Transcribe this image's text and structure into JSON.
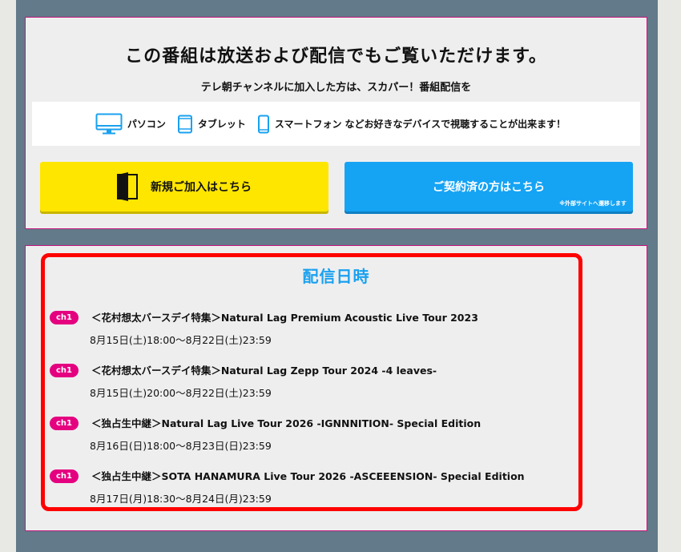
{
  "promo": {
    "headline": "この番組は放送および配信でもご覧いただけます。",
    "subline": "テレ朝チャンネルに加入した方は、スカパー！番組配信を",
    "devices": [
      {
        "icon": "monitor-icon",
        "label": "パソコン"
      },
      {
        "icon": "tablet-icon",
        "label": "タブレット"
      },
      {
        "icon": "smartphone-icon",
        "label": "スマートフォン"
      }
    ],
    "devices_tail": "などお好きなデバイスで視聴することが出来ます！",
    "new_button": {
      "label": "新規ご加入はこちら",
      "icon": "door-icon",
      "color": "#ffe600"
    },
    "member_button": {
      "label": "ご契約済の方はこちら",
      "note": "※外部サイトへ遷移します",
      "color": "#15a3f4"
    }
  },
  "schedule": {
    "title": "配信日時",
    "entries": [
      {
        "channel": "ch1",
        "title": "＜花村想太バースデイ特集＞Natural Lag Premium Acoustic Live Tour 2023",
        "datetime": "8月15日(土)18:00～8月22日(土)23:59"
      },
      {
        "channel": "ch1",
        "title": "＜花村想太バースデイ特集＞Natural Lag Zepp Tour 2024 -4 leaves-",
        "datetime": "8月15日(土)20:00～8月22日(土)23:59"
      },
      {
        "channel": "ch1",
        "title": "＜独占生中継＞Natural Lag Live Tour 2026 -IGNNNITION- Special Edition",
        "datetime": "8月16日(日)18:00～8月23日(日)23:59"
      },
      {
        "channel": "ch1",
        "title": "＜独占生中継＞SOTA HANAMURA Live Tour 2026 -ASCEEENSION- Special Edition",
        "datetime": "8月17日(月)18:30～8月24日(月)23:59"
      }
    ]
  },
  "colors": {
    "accent": "#1aa1ef",
    "badge": "#e4007f",
    "panel_border": "#c2187e",
    "highlight": "#ff0000"
  }
}
